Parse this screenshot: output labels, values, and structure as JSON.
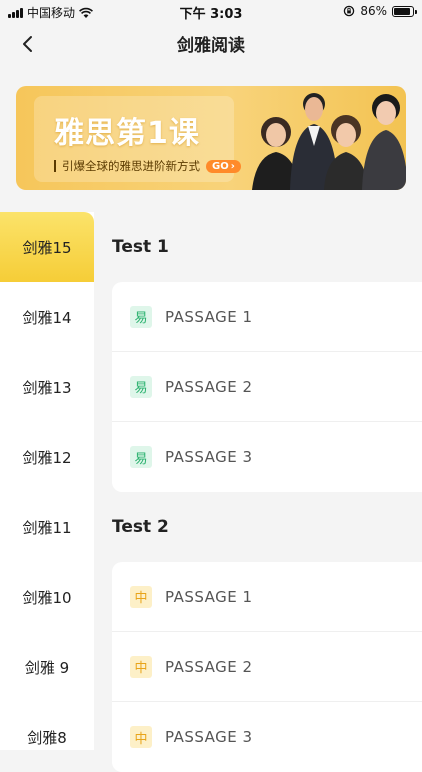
{
  "status_bar": {
    "carrier": "中国移动",
    "time": "下午 3:03",
    "battery": "86%",
    "battery_level": 0.86
  },
  "nav": {
    "title": "剑雅阅读"
  },
  "banner": {
    "title": "雅思第1课",
    "subtitle": "引爆全球的雅思进阶新方式",
    "cta": "GO"
  },
  "sidebar": {
    "items": [
      {
        "label": "剑雅15",
        "active": true
      },
      {
        "label": "剑雅14"
      },
      {
        "label": "剑雅13"
      },
      {
        "label": "剑雅12"
      },
      {
        "label": "剑雅11"
      },
      {
        "label": "剑雅10"
      },
      {
        "label": "剑雅 9"
      },
      {
        "label": "剑雅8"
      }
    ]
  },
  "tests": [
    {
      "title": "Test 1",
      "passages": [
        {
          "difficulty": "易",
          "level": "easy",
          "label": "PASSAGE 1"
        },
        {
          "difficulty": "易",
          "level": "easy",
          "label": "PASSAGE 2"
        },
        {
          "difficulty": "易",
          "level": "easy",
          "label": "PASSAGE 3"
        }
      ]
    },
    {
      "title": "Test 2",
      "passages": [
        {
          "difficulty": "中",
          "level": "mid",
          "label": "PASSAGE 1"
        },
        {
          "difficulty": "中",
          "level": "mid",
          "label": "PASSAGE 2"
        },
        {
          "difficulty": "中",
          "level": "mid",
          "label": "PASSAGE 3"
        }
      ]
    }
  ],
  "colors": {
    "accent": "#f6cd37",
    "easy": "#27b06c",
    "mid": "#e8a41a"
  }
}
